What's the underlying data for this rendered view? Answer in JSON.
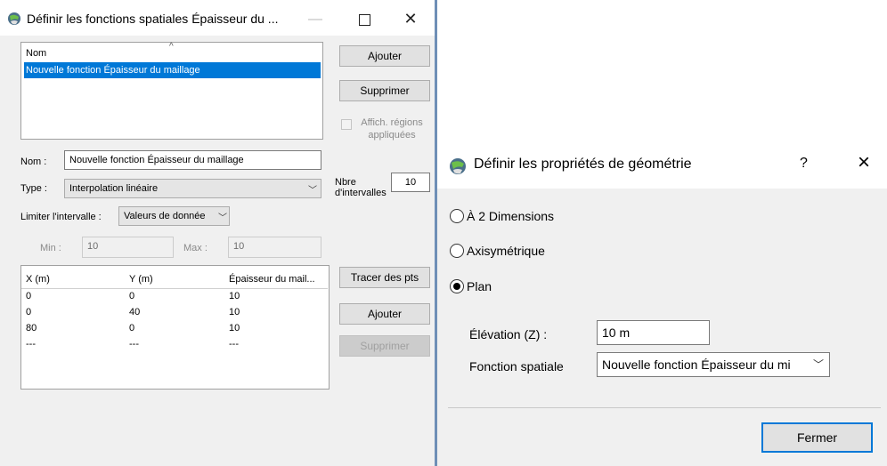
{
  "dialog1": {
    "title": "Définir les fonctions spatiales Épaisseur du ...",
    "list": {
      "header": "Nom",
      "items": [
        "Nouvelle fonction Épaisseur du maillage"
      ]
    },
    "buttons": {
      "add": "Ajouter",
      "delete": "Supprimer",
      "plot": "Tracer des pts",
      "add2": "Ajouter",
      "delete2": "Supprimer"
    },
    "show_regions": "Affich. régions appliquées",
    "name_label": "Nom :",
    "name_value": "Nouvelle fonction Épaisseur du maillage",
    "type_label": "Type :",
    "type_value": "Interpolation linéaire",
    "intervals_label": "Nbre d'intervalles",
    "intervals_value": "10",
    "limit_label": "Limiter l'intervalle :",
    "limit_value": "Valeurs de donnée",
    "min_label": "Min :",
    "min_value": "10",
    "max_label": "Max :",
    "max_value": "10",
    "table": {
      "headers": [
        "X (m)",
        "Y (m)",
        "Épaisseur du mail..."
      ],
      "rows": [
        [
          "0",
          "0",
          "10"
        ],
        [
          "0",
          "40",
          "10"
        ],
        [
          "80",
          "0",
          "10"
        ],
        [
          "---",
          "---",
          "---"
        ]
      ]
    }
  },
  "dialog2": {
    "title": "Définir les propriétés de géométrie",
    "help": "?",
    "close": "×",
    "options": [
      "À 2 Dimensions",
      "Axisymétrique",
      "Plan"
    ],
    "selected_option": "Plan",
    "elevation_label": "Élévation (Z) :",
    "elevation_value": "10 m",
    "spatial_label": "Fonction spatiale",
    "spatial_value": "Nouvelle fonction Épaisseur du mi",
    "close_button": "Fermer"
  },
  "colors": {
    "selection": "#0078d7",
    "window_border": "#6f8fb6"
  }
}
